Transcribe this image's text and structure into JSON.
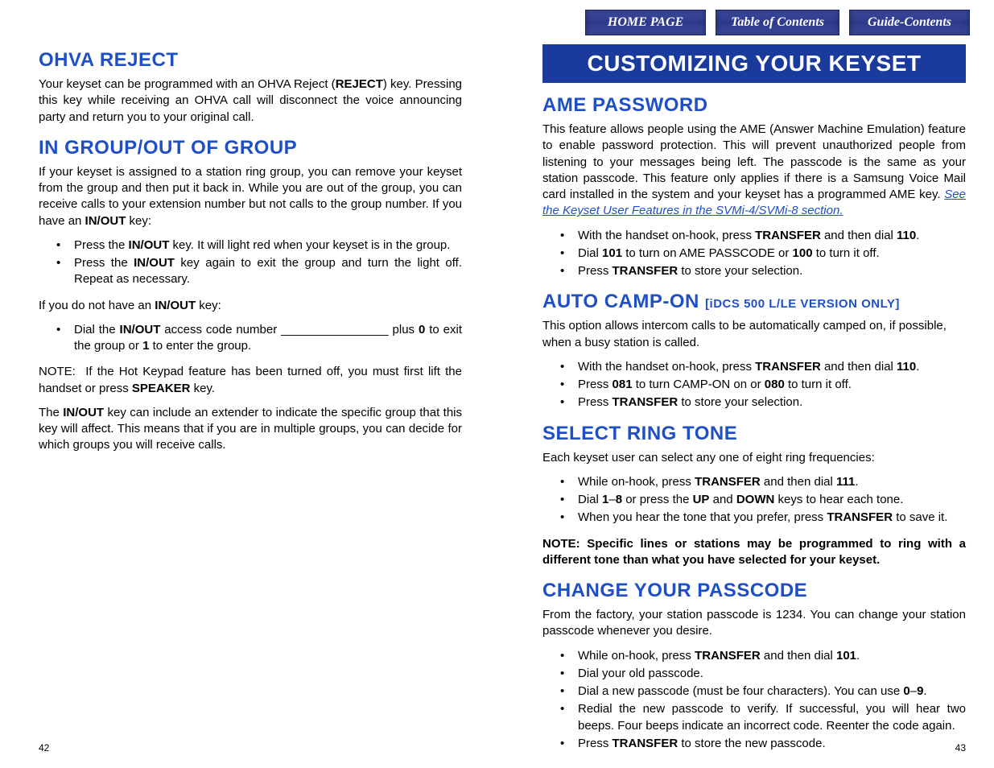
{
  "nav": {
    "home": "HOME PAGE",
    "toc": "Table of Contents",
    "guide": "Guide-Contents"
  },
  "left": {
    "h_ohva": "OHVA REJECT",
    "p_ohva": "Your keyset can be programmed with an OHVA Reject (REJECT) key. Pressing this key while receiving an OHVA call will disconnect the voice announcing party and return you to your original call.",
    "h_group": "IN GROUP/OUT OF GROUP",
    "p_group1": "If your keyset is assigned to a station ring group, you can remove your keyset from the group and then put it back in. While you are out of the group, you can receive calls to your extension number but not calls to the group number. If you have an IN/OUT key:",
    "li_g1": "Press the IN/OUT key. It will light red when your keyset is in the group.",
    "li_g2": "Press the IN/OUT key again to exit the group and turn the light off. Repeat as necessary.",
    "p_group2": "If you do not have an IN/OUT key:",
    "li_g3": "Dial the IN/OUT access code number ________________ plus 0 to exit the group or 1 to enter the group.",
    "p_group3": "NOTE:  If the Hot Keypad feature has been turned off, you must first lift the handset or press SPEAKER key.",
    "p_group4": "The IN/OUT key can include an extender to indicate the specific group that this key will affect. This means that if you are in multiple groups, you can decide for which groups you will receive calls.",
    "page": "42"
  },
  "right": {
    "banner": "CUSTOMIZING YOUR KEYSET",
    "h_ame": "AME PASSWORD",
    "p_ame": "This feature allows people using the AME (Answer Machine Emulation) feature to enable password protection. This will prevent unauthorized people from listening to your messages being left. The passcode is the same as your station passcode. This feature only applies if there is a Samsung Voice Mail card installed in the system and your keyset has a programmed AME key. ",
    "link_ame": "See the Keyset User Features in the SVMi-4/SVMi-8 section.",
    "li_a1": "With the handset on-hook, press TRANSFER and then dial 110.",
    "li_a2": "Dial 101 to turn on AME PASSCODE or 100 to turn it off.",
    "li_a3": "Press TRANSFER to store your selection.",
    "h_camp": "AUTO CAMP-ON ",
    "h_camp_sub": "[iDCS 500 L/LE VERSION ONLY]",
    "p_camp": "This option allows intercom calls to be automatically camped on, if possible, when a busy station is called.",
    "li_c1": "With the handset on-hook, press TRANSFER and then dial 110.",
    "li_c2": "Press 081 to turn CAMP-ON on or 080 to turn it off.",
    "li_c3": "Press TRANSFER to store your selection.",
    "h_ring": "SELECT RING TONE",
    "p_ring": "Each keyset user can select any one of eight ring frequencies:",
    "li_r1": "While on-hook, press TRANSFER and then dial 111.",
    "li_r2": "Dial 1–8 or press the UP and DOWN keys to hear each tone.",
    "li_r3": "When you hear the tone that you prefer, press TRANSFER to save it.",
    "note_ring": "NOTE: Specific lines or stations may be programmed to ring with a different tone than what you have selected for your keyset.",
    "h_pass": "CHANGE YOUR PASSCODE",
    "p_pass": "From the factory, your station passcode is 1234. You can change your station passcode whenever you desire.",
    "li_p1": "While on-hook, press TRANSFER and then dial 101.",
    "li_p2": "Dial your old passcode.",
    "li_p3": "Dial a new passcode (must be four characters). You can use 0–9.",
    "li_p4": "Redial the new passcode to verify. If successful, you will hear two beeps. Four beeps indicate an incorrect code. Reenter the code again.",
    "li_p5": "Press TRANSFER to store the new passcode.",
    "page": "43"
  }
}
